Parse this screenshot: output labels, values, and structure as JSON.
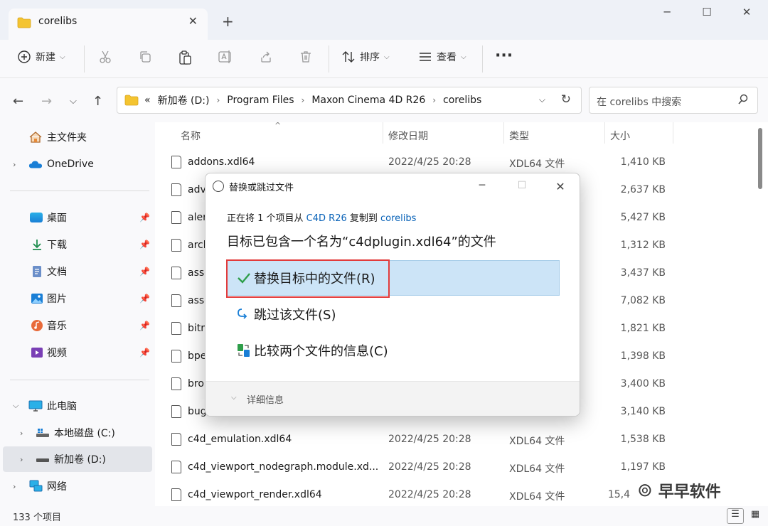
{
  "window": {
    "tab_title": "corelibs",
    "tab_close": "✕",
    "new_tab": "+",
    "minimize": "─",
    "maximize": "☐",
    "close": "✕"
  },
  "toolbar": {
    "new_label": "新建",
    "sort_label": "排序",
    "view_label": "查看",
    "more": "···"
  },
  "address": {
    "overflow": "«",
    "crumbs": [
      "新加卷 (D:)",
      "Program Files",
      "Maxon Cinema 4D R26",
      "corelibs"
    ],
    "search_placeholder": "在 corelibs 中搜索"
  },
  "sidebar": {
    "home": "主文件夹",
    "onedrive": "OneDrive",
    "desktop": "桌面",
    "downloads": "下载",
    "documents": "文档",
    "pictures": "图片",
    "music": "音乐",
    "videos": "视频",
    "this_pc": "此电脑",
    "local_disk": "本地磁盘 (C:)",
    "new_volume": "新加卷 (D:)",
    "network": "网络"
  },
  "columns": {
    "name": "名称",
    "modified": "修改日期",
    "type": "类型",
    "size": "大小"
  },
  "files": [
    {
      "name": "addons.xdl64",
      "date": "2022/4/25 20:28",
      "type": "XDL64 文件",
      "size": "1,410 KB"
    },
    {
      "name": "adv",
      "date": "",
      "type": "",
      "size": "2,637 KB"
    },
    {
      "name": "aler",
      "date": "",
      "type": "",
      "size": "5,427 KB"
    },
    {
      "name": "arch",
      "date": "",
      "type": "",
      "size": "1,312 KB"
    },
    {
      "name": "asse",
      "date": "",
      "type": "",
      "size": "3,437 KB"
    },
    {
      "name": "asse",
      "date": "",
      "type": "",
      "size": "7,082 KB"
    },
    {
      "name": "bitr",
      "date": "",
      "type": "",
      "size": "1,821 KB"
    },
    {
      "name": "bpe",
      "date": "",
      "type": "",
      "size": "1,398 KB"
    },
    {
      "name": "bro",
      "date": "",
      "type": "",
      "size": "3,400 KB"
    },
    {
      "name": "bug",
      "date": "",
      "type": "",
      "size": "3,140 KB"
    },
    {
      "name": "c4d_emulation.xdl64",
      "date": "2022/4/25 20:28",
      "type": "XDL64 文件",
      "size": "1,538 KB"
    },
    {
      "name": "c4d_viewport_nodegraph.module.xd...",
      "date": "2022/4/25 20:28",
      "type": "XDL64 文件",
      "size": "1,197 KB"
    },
    {
      "name": "c4d_viewport_render.xdl64",
      "date": "2022/4/25 20:28",
      "type": "XDL64 文件",
      "size": "15,4"
    }
  ],
  "status": {
    "count": "133 个项目"
  },
  "watermark": "早早软件",
  "dialog": {
    "title": "替换或跳过文件",
    "info_prefix": "正在将 1 个项目从 ",
    "info_source": "C4D R26",
    "info_mid": " 复制到 ",
    "info_dest": "corelibs",
    "heading": "目标已包含一个名为“c4dplugin.xdl64”的文件",
    "option_replace": "替换目标中的文件(R)",
    "option_skip": "跳过该文件(S)",
    "option_compare": "比较两个文件的信息(C)",
    "details": "详细信息"
  },
  "colors": {
    "accent": "#0a63b8",
    "highlight": "#cce4f7",
    "annotation_red": "#e23b3b",
    "folder_yellow": "#f4c430"
  }
}
